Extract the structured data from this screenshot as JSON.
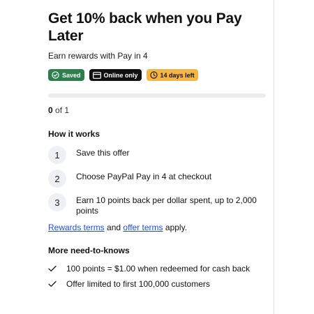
{
  "offer": {
    "title": "Get 10% back when you Pay Later",
    "subtitle": "Earn rewards with Pay in 4"
  },
  "badges": [
    {
      "label": "Saved",
      "icon": "check-circle-icon",
      "color": "#2e7d4f"
    },
    {
      "label": "Online only",
      "icon": "card-icon",
      "color": "#111111"
    },
    {
      "label": "14 days left",
      "icon": "clock-icon",
      "color": "#f4b545"
    }
  ],
  "progress": {
    "current": "0",
    "total_text": "of 1",
    "fraction": 0
  },
  "how_it_works": {
    "title": "How it works",
    "steps": [
      {
        "number": "1",
        "text": "Save this offer"
      },
      {
        "number": "2",
        "text": "Choose PayPal Pay in 4 at checkout"
      },
      {
        "number": "3",
        "text": "Earn 10 points back per dollar spent, up to 2,000 points"
      }
    ]
  },
  "terms": {
    "rewards_link": "Rewards terms",
    "and_text": "and",
    "offer_link": "offer terms",
    "apply_text": "apply."
  },
  "more": {
    "title": "More need-to-knows",
    "items": [
      "100 points = $1.00 when redeemed for cash back",
      "Offer limited to first 100,000 customers"
    ]
  },
  "colors": {
    "link": "#1f4fd6",
    "progress_track": "#ececee",
    "step_circle": "#eef0f4"
  }
}
